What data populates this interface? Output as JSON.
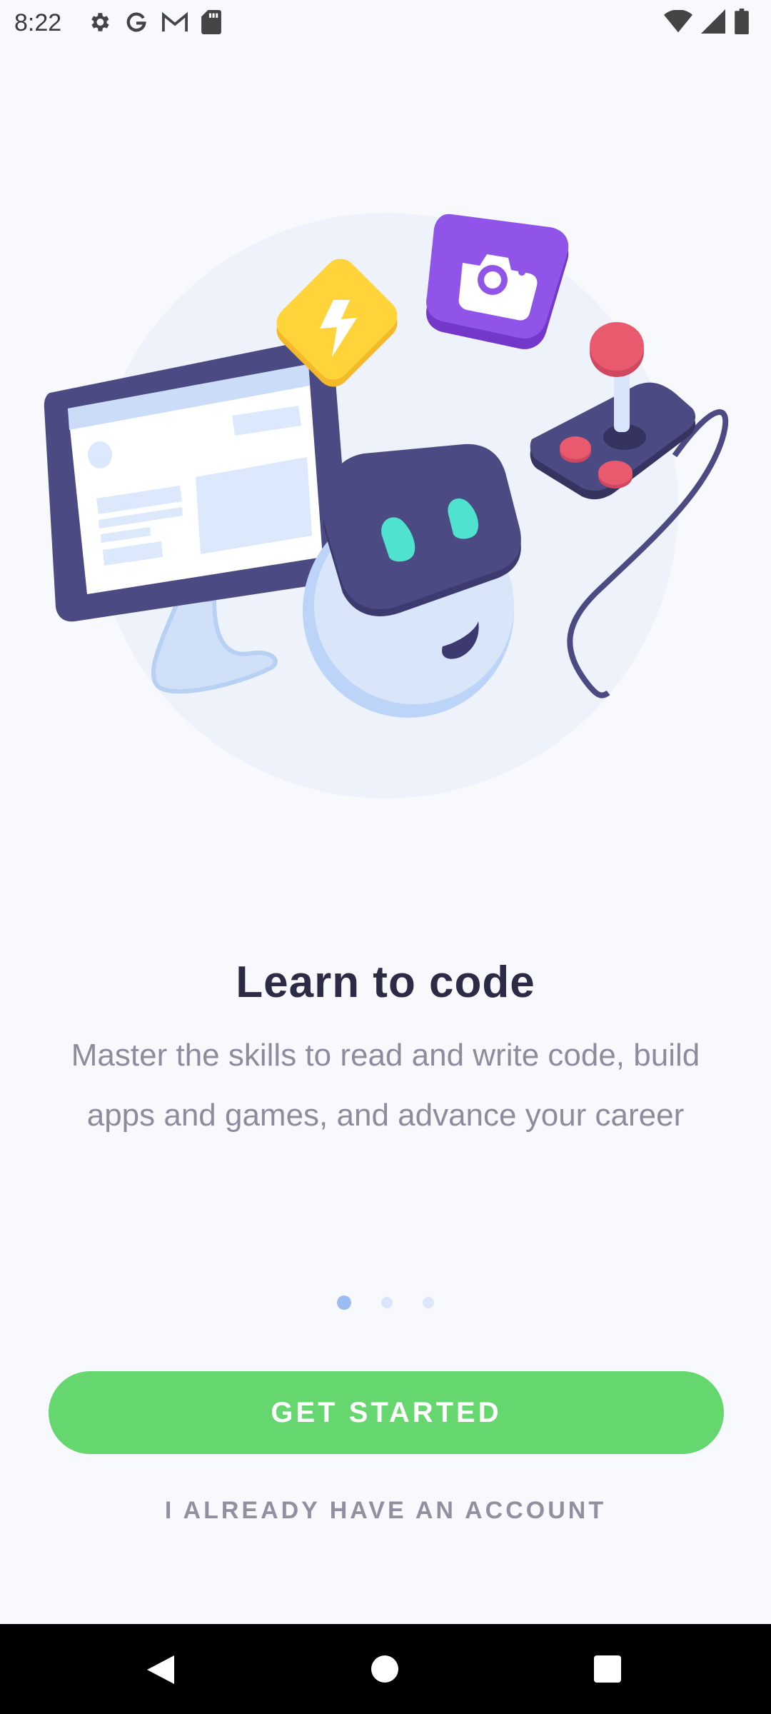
{
  "status_bar": {
    "time": "8:22",
    "left_icons": [
      "settings-icon",
      "google-icon",
      "gmail-icon",
      "sd-card-icon"
    ],
    "right_icons": [
      "wifi-icon",
      "signal-icon",
      "battery-icon"
    ]
  },
  "onboarding": {
    "title": "Learn to code",
    "subtitle": "Master the skills to read and write code, build apps and games, and advance your career",
    "page_count": 3,
    "active_page": 1
  },
  "actions": {
    "primary_label": "GET STARTED",
    "secondary_label": "I ALREADY HAVE AN ACCOUNT"
  },
  "colors": {
    "primary": "#66d76f",
    "title": "#2b2b45",
    "subtitle": "#8c8c9e",
    "dot_active": "#9bbcf0",
    "dot_inactive": "#dbe6fb",
    "background": "#f8f9fd"
  },
  "navigation": {
    "icons": [
      "back-icon",
      "home-icon",
      "recents-icon"
    ]
  }
}
